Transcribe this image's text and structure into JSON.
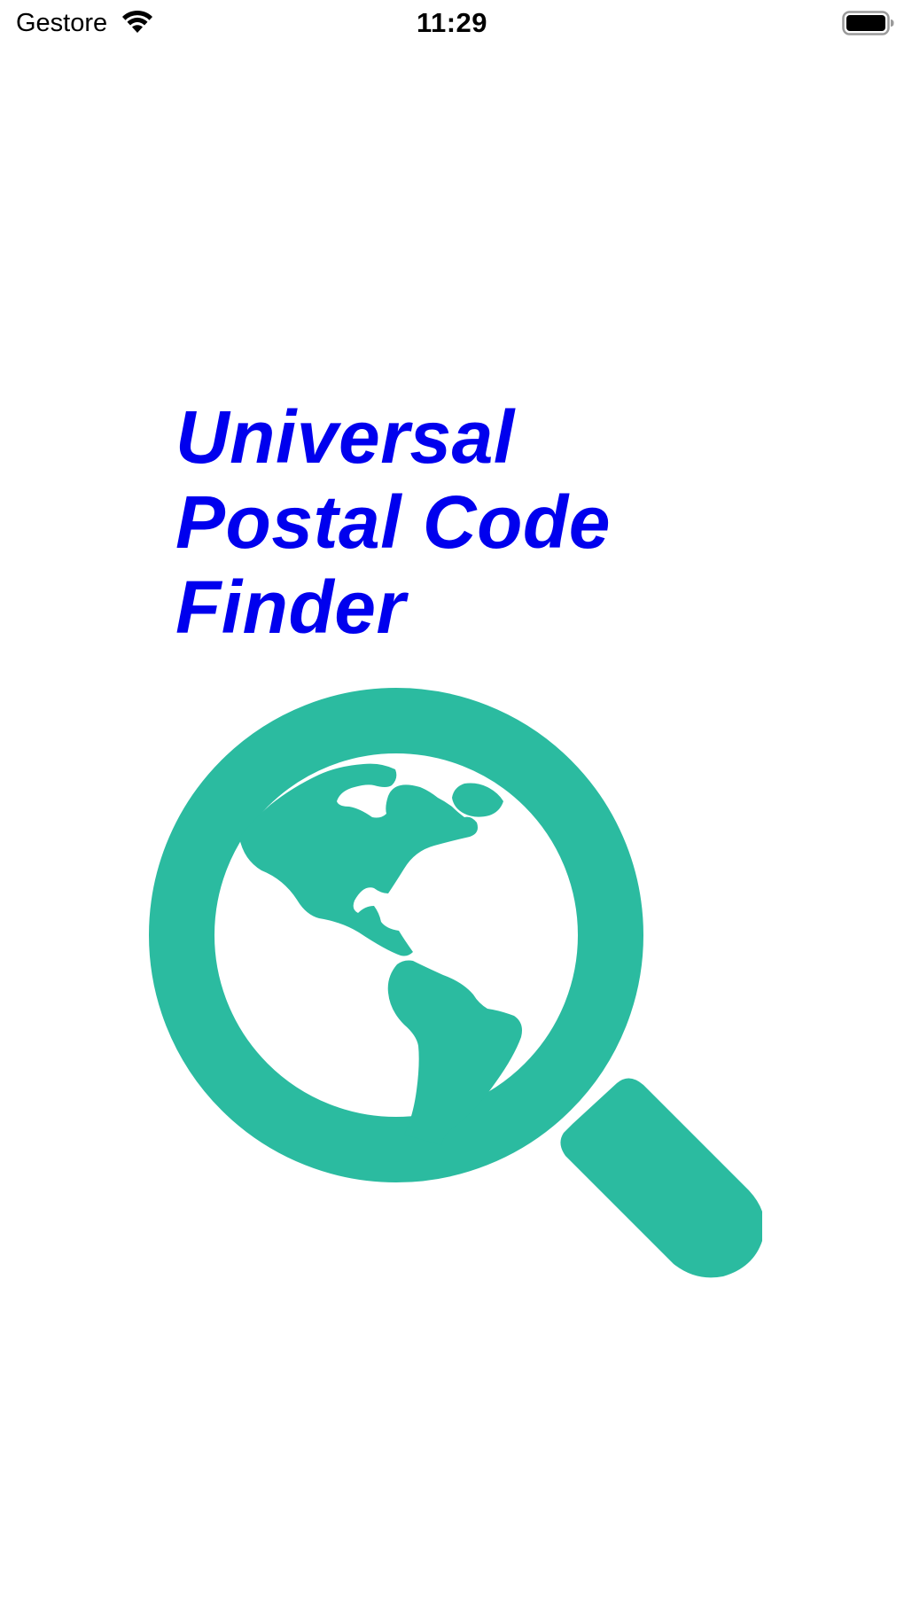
{
  "status_bar": {
    "carrier": "Gestore",
    "time": "11:29",
    "icons": [
      "wifi-icon",
      "battery-icon"
    ]
  },
  "app": {
    "title_lines": [
      "Universal",
      "Postal Code",
      "Finder"
    ],
    "title_color": "#0000ee",
    "logo": "magnifier-globe-icon",
    "logo_color": "#2bbba0"
  }
}
